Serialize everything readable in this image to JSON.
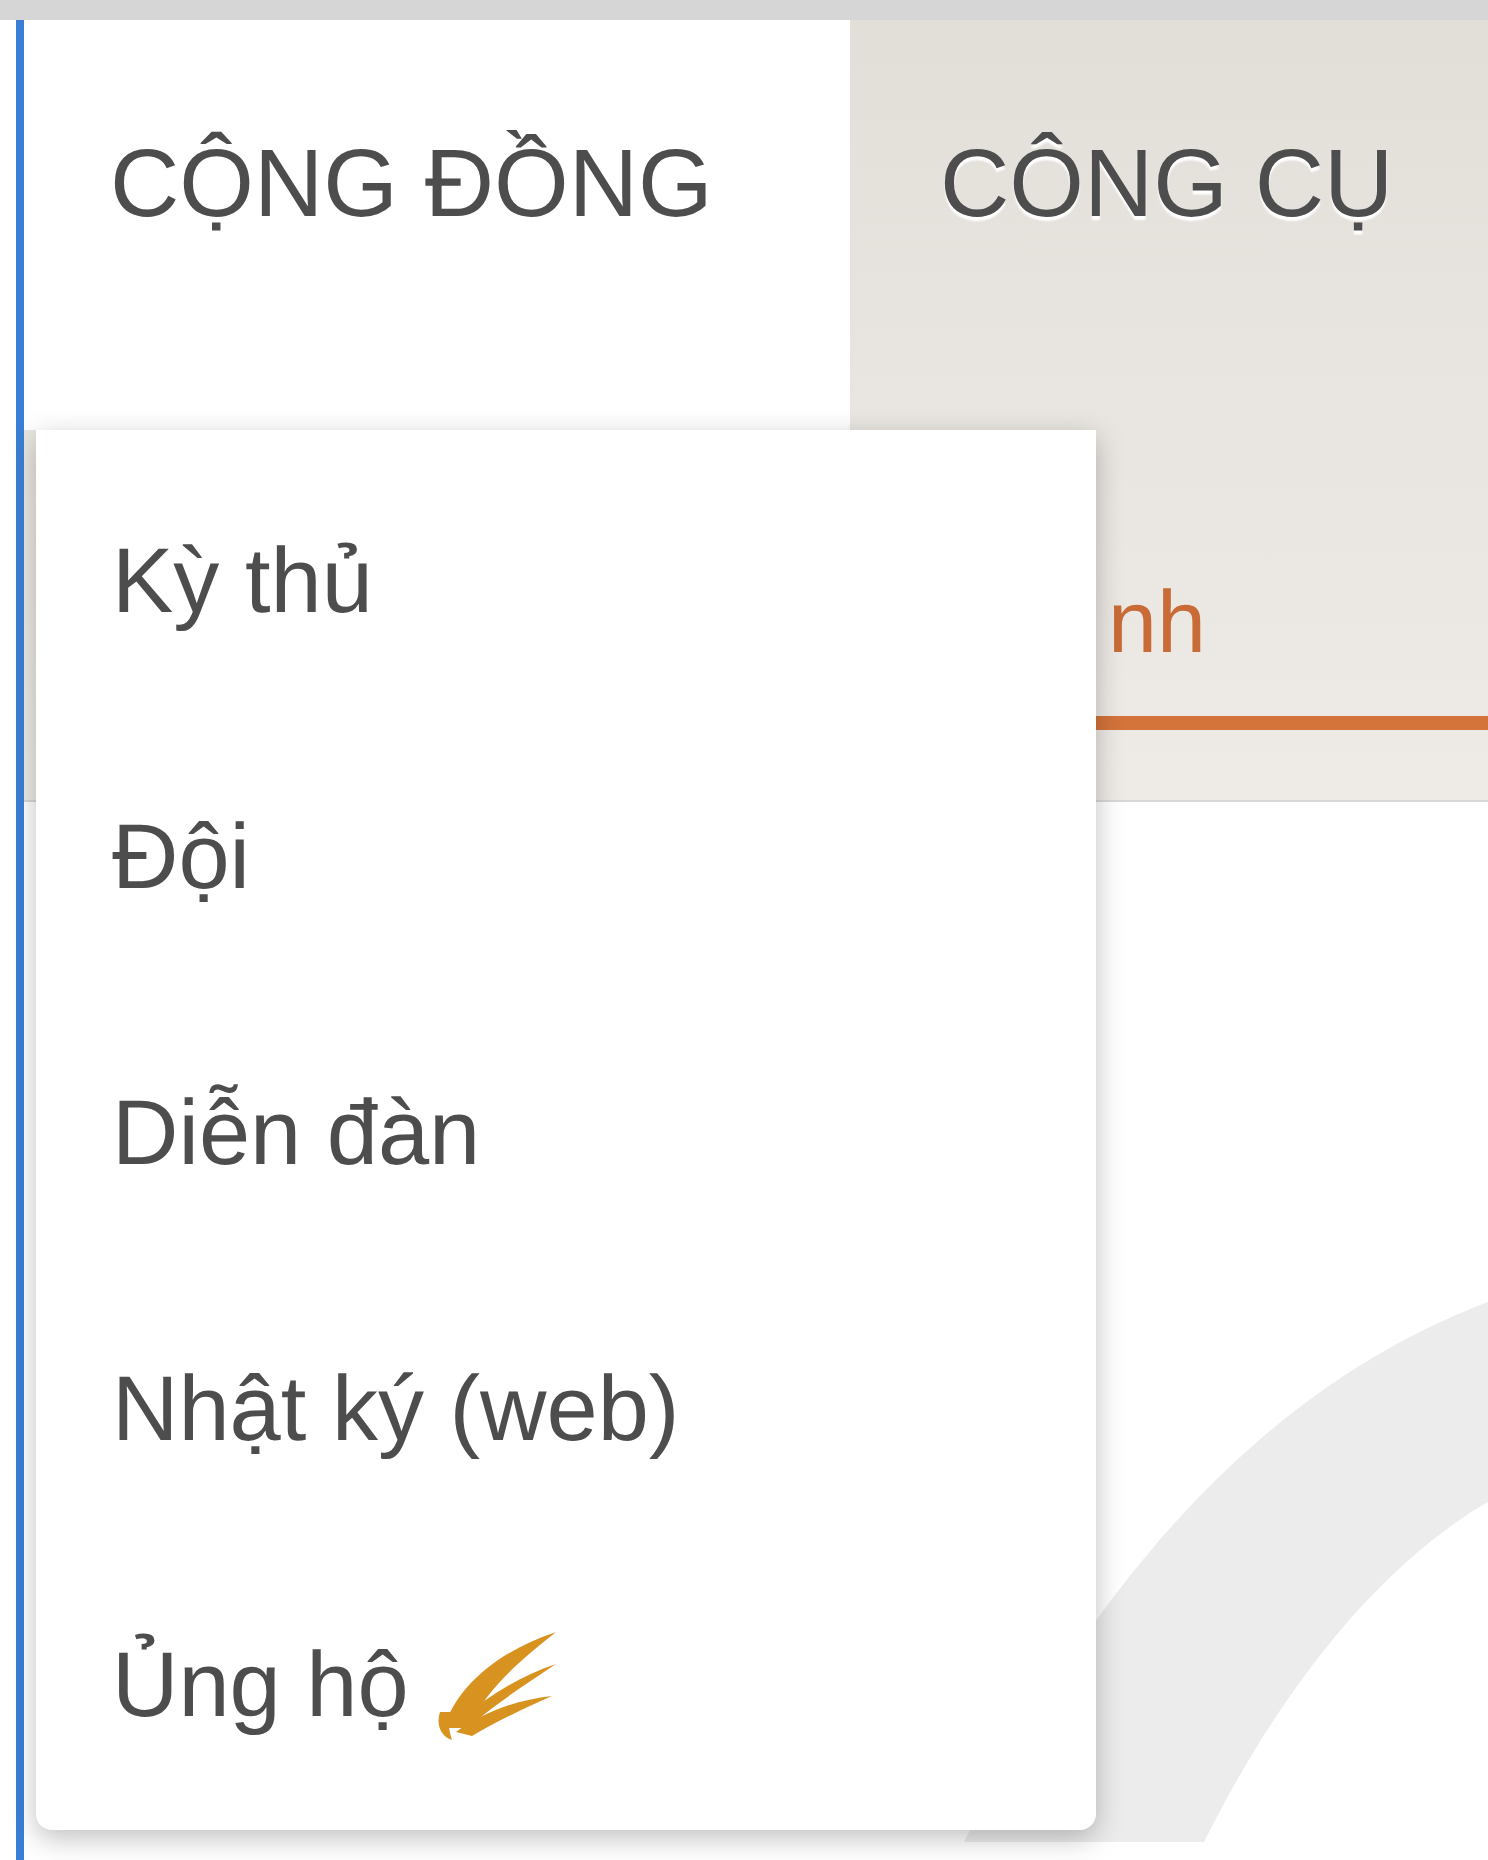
{
  "nav_tabs": [
    {
      "label": "CỘNG ĐỒNG",
      "selected": true
    },
    {
      "label": "CÔNG CỤ",
      "selected": false
    }
  ],
  "sub_tab": {
    "label": "nh",
    "selected": true
  },
  "dropdown_menu": {
    "items": [
      {
        "label": "Kỳ thủ",
        "kind": "link"
      },
      {
        "label": "Đội",
        "kind": "link"
      },
      {
        "label": "Diễn đàn",
        "kind": "link"
      },
      {
        "label": "Nhật ký (web)",
        "kind": "link"
      },
      {
        "label": "Ủng hộ",
        "kind": "donate"
      }
    ]
  }
}
